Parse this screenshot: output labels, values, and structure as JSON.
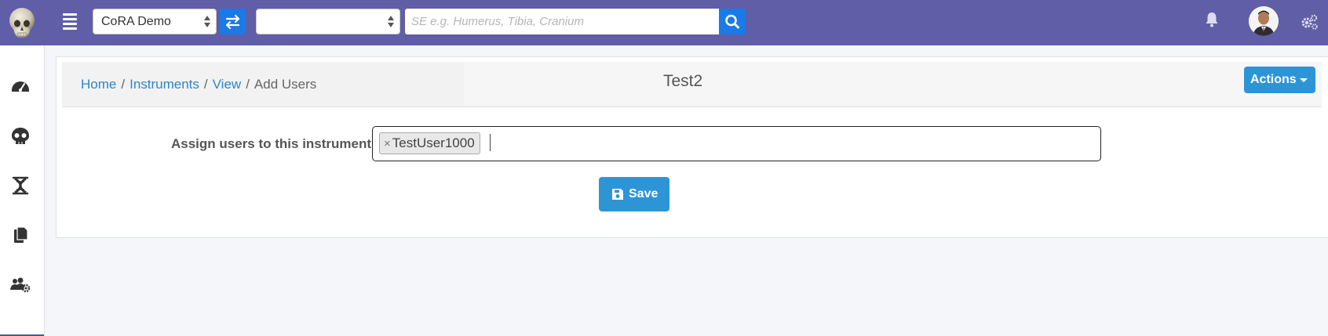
{
  "topbar": {
    "project_select": "CoRA Demo",
    "second_select": "",
    "search_placeholder": "SE e.g. Humerus, Tibia, Cranium",
    "accent_color": "#5f5ea6",
    "button_color": "#1a7ae8"
  },
  "sidebar": {
    "icons": [
      "dashboard-icon",
      "skull-icon",
      "dna-icon",
      "documents-icon",
      "users-gear-icon"
    ]
  },
  "breadcrumb": {
    "home": "Home",
    "instruments": "Instruments",
    "view": "View",
    "current": "Add Users",
    "separator": "/"
  },
  "page": {
    "title": "Test2",
    "actions_label": "Actions"
  },
  "form": {
    "label": "Assign users to this instrument",
    "tags": [
      {
        "remove": "×",
        "label": "TestUser1000"
      }
    ],
    "save_label": "Save",
    "primary_color": "#2d95d6"
  }
}
